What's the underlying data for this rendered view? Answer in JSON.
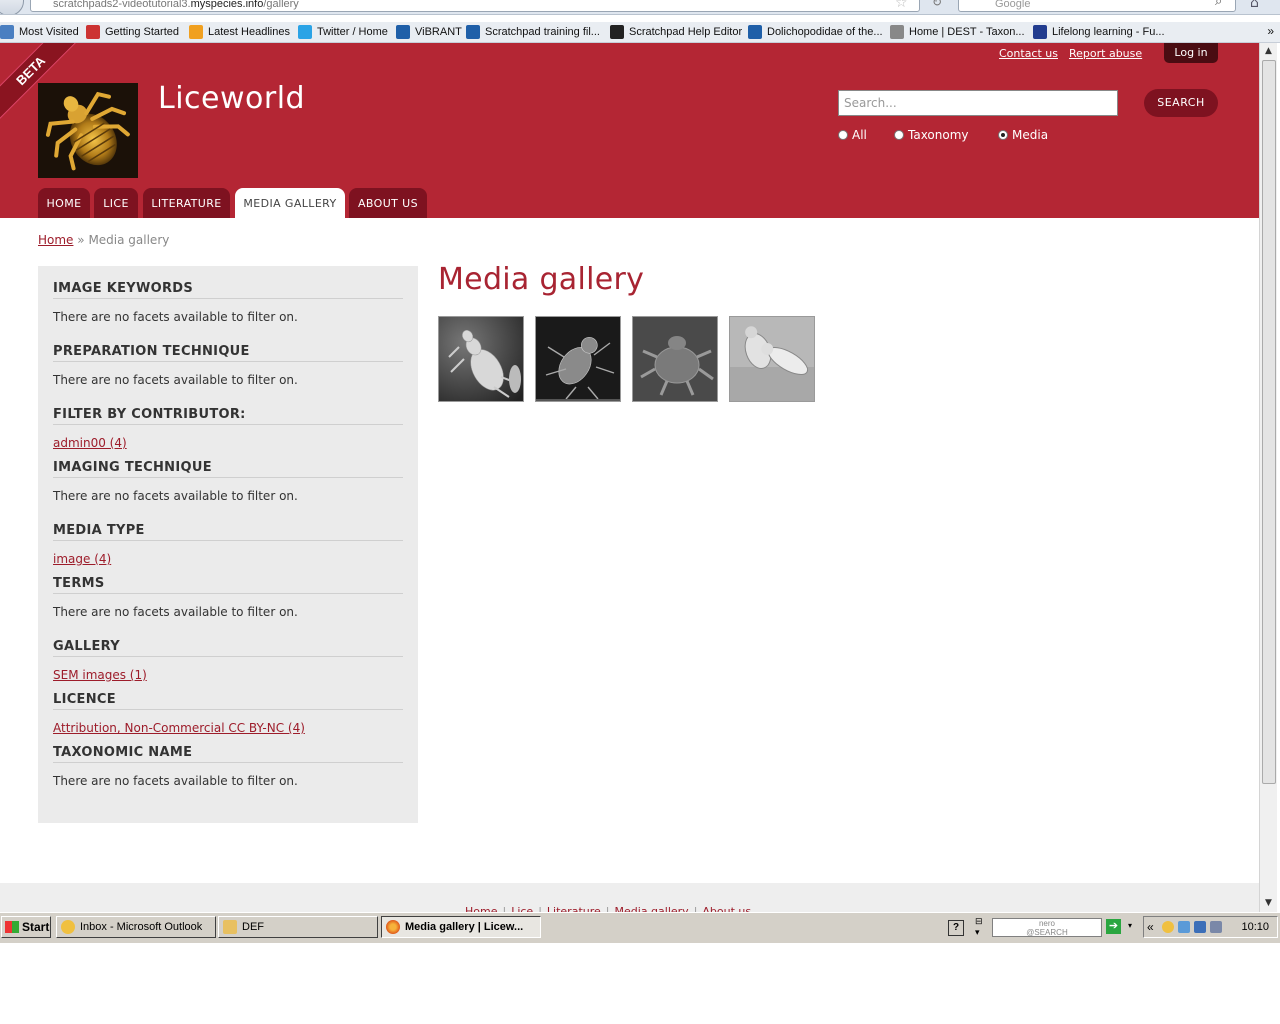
{
  "browser": {
    "url_prefix": "scratchpads2-videotutorial3.",
    "url_domain": "myspecies.info",
    "url_path": "/gallery",
    "search_engine_label": "Google",
    "bookmarks": [
      {
        "label": "Most Visited",
        "color": "#4a7fc1"
      },
      {
        "label": "Getting Started",
        "color": "#c33"
      },
      {
        "label": "Latest Headlines",
        "color": "#f0a020"
      },
      {
        "label": "Twitter / Home",
        "color": "#2aa3e6"
      },
      {
        "label": "ViBRANT",
        "color": "#1f5fa8"
      },
      {
        "label": "Scratchpad training fil...",
        "color": "#1f5fa8"
      },
      {
        "label": "Scratchpad Help Editor",
        "color": "#222"
      },
      {
        "label": "Dolichopodidae of the...",
        "color": "#1f5fa8"
      },
      {
        "label": "Home | DEST - Taxon...",
        "color": "#888"
      },
      {
        "label": "Lifelong learning - Fu...",
        "color": "#223c8f"
      }
    ],
    "bookmarks_overflow": "»"
  },
  "site": {
    "beta_label": "BETA",
    "name": "Liceworld",
    "secondary_links": [
      "Contact us",
      "Report abuse"
    ],
    "login_label": "Log in",
    "search_placeholder": "Search...",
    "search_button": "SEARCH",
    "search_scope": [
      {
        "label": "All",
        "selected": false
      },
      {
        "label": "Taxonomy",
        "selected": false
      },
      {
        "label": "Media",
        "selected": true
      }
    ],
    "nav": [
      {
        "label": "HOME",
        "active": false
      },
      {
        "label": "LICE",
        "active": false
      },
      {
        "label": "LITERATURE",
        "active": false
      },
      {
        "label": "MEDIA GALLERY",
        "active": true
      },
      {
        "label": "ABOUT US",
        "active": false
      }
    ],
    "brand_color": "#b42634"
  },
  "breadcrumb": {
    "home": "Home",
    "separator": "»",
    "current": "Media gallery"
  },
  "facets": [
    {
      "title": "IMAGE KEYWORDS",
      "body": "There are no facets available to filter on.",
      "link": false
    },
    {
      "title": "PREPARATION TECHNIQUE",
      "body": "There are no facets available to filter on.",
      "link": false
    },
    {
      "title": "FILTER BY CONTRIBUTOR:",
      "body": "admin00 (4)",
      "link": true
    },
    {
      "title": "IMAGING TECHNIQUE",
      "body": "There are no facets available to filter on.",
      "link": false
    },
    {
      "title": "MEDIA TYPE",
      "body": "image (4)",
      "link": true
    },
    {
      "title": "TERMS",
      "body": "There are no facets available to filter on.",
      "link": false
    },
    {
      "title": "GALLERY",
      "body": "SEM images (1)",
      "link": true
    },
    {
      "title": "LICENCE",
      "body": "Attribution, Non-Commercial CC BY-NC (4)",
      "link": true
    },
    {
      "title": "TAXONOMIC NAME",
      "body": "There are no facets available to filter on.",
      "link": false
    }
  ],
  "main": {
    "title": "Media gallery",
    "thumbnails": [
      "sem-louse-thumbnail",
      "sem-louse-thumbnail",
      "sem-louse-thumbnail",
      "sem-louse-thumbnail"
    ]
  },
  "footer": {
    "links": [
      "Home",
      "Lice",
      "Literature",
      "Media gallery",
      "About us"
    ]
  },
  "taskbar": {
    "start_label": "Start",
    "tasks": [
      {
        "label": "Inbox - Microsoft Outlook",
        "active": false,
        "color": "#f0c040"
      },
      {
        "label": "DEF",
        "active": false,
        "color": "#e8c060"
      },
      {
        "label": "Media gallery | Licew...",
        "active": true,
        "color": "#e06020"
      }
    ],
    "help_label": "?",
    "nero_label": "nero",
    "nero_sub": "@SEARCH",
    "tray_chevron": "«",
    "clock": "10:10"
  }
}
